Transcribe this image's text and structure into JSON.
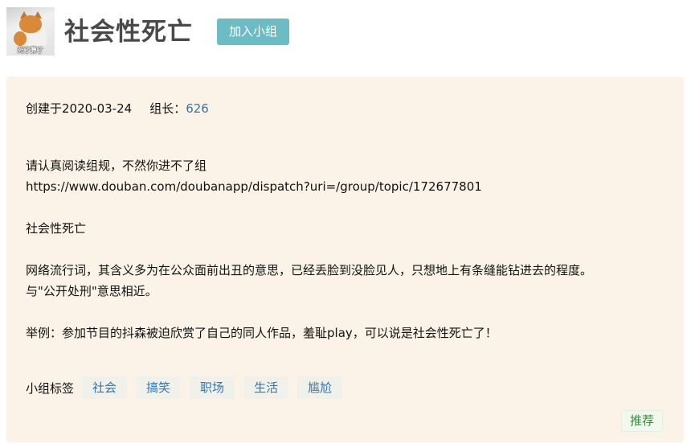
{
  "header": {
    "avatar_caption": "死了算了",
    "title": "社会性死亡",
    "join_label": "加入小组"
  },
  "meta": {
    "created": "创建于2020-03-24",
    "owner_label": "组长：",
    "owner_name": "626"
  },
  "intro": {
    "lines": [
      "请认真阅读组规，不然你进不了组",
      "https://www.douban.com/doubanapp/dispatch?uri=/group/topic/172677801",
      "",
      "社会性死亡",
      "",
      "网络流行词，其含义多为在公众面前出丑的意思，已经丢脸到没脸见人，只想地上有条缝能钻进去的程度。",
      "与\"公开处刑\"意思相近。",
      "",
      "举例：参加节目的抖森被迫欣赏了自己的同人作品，羞耻play，可以说是社会性死亡了！"
    ]
  },
  "tags": {
    "label": "小组标签",
    "items": [
      "社会",
      "搞笑",
      "职场",
      "生活",
      "尴尬"
    ]
  },
  "recommend_label": "推荐",
  "colors": {
    "join_button": "#6bbcc4",
    "card_background": "#fcf3e8",
    "link": "#3377aa",
    "recommend_text": "#3b8b3b"
  }
}
